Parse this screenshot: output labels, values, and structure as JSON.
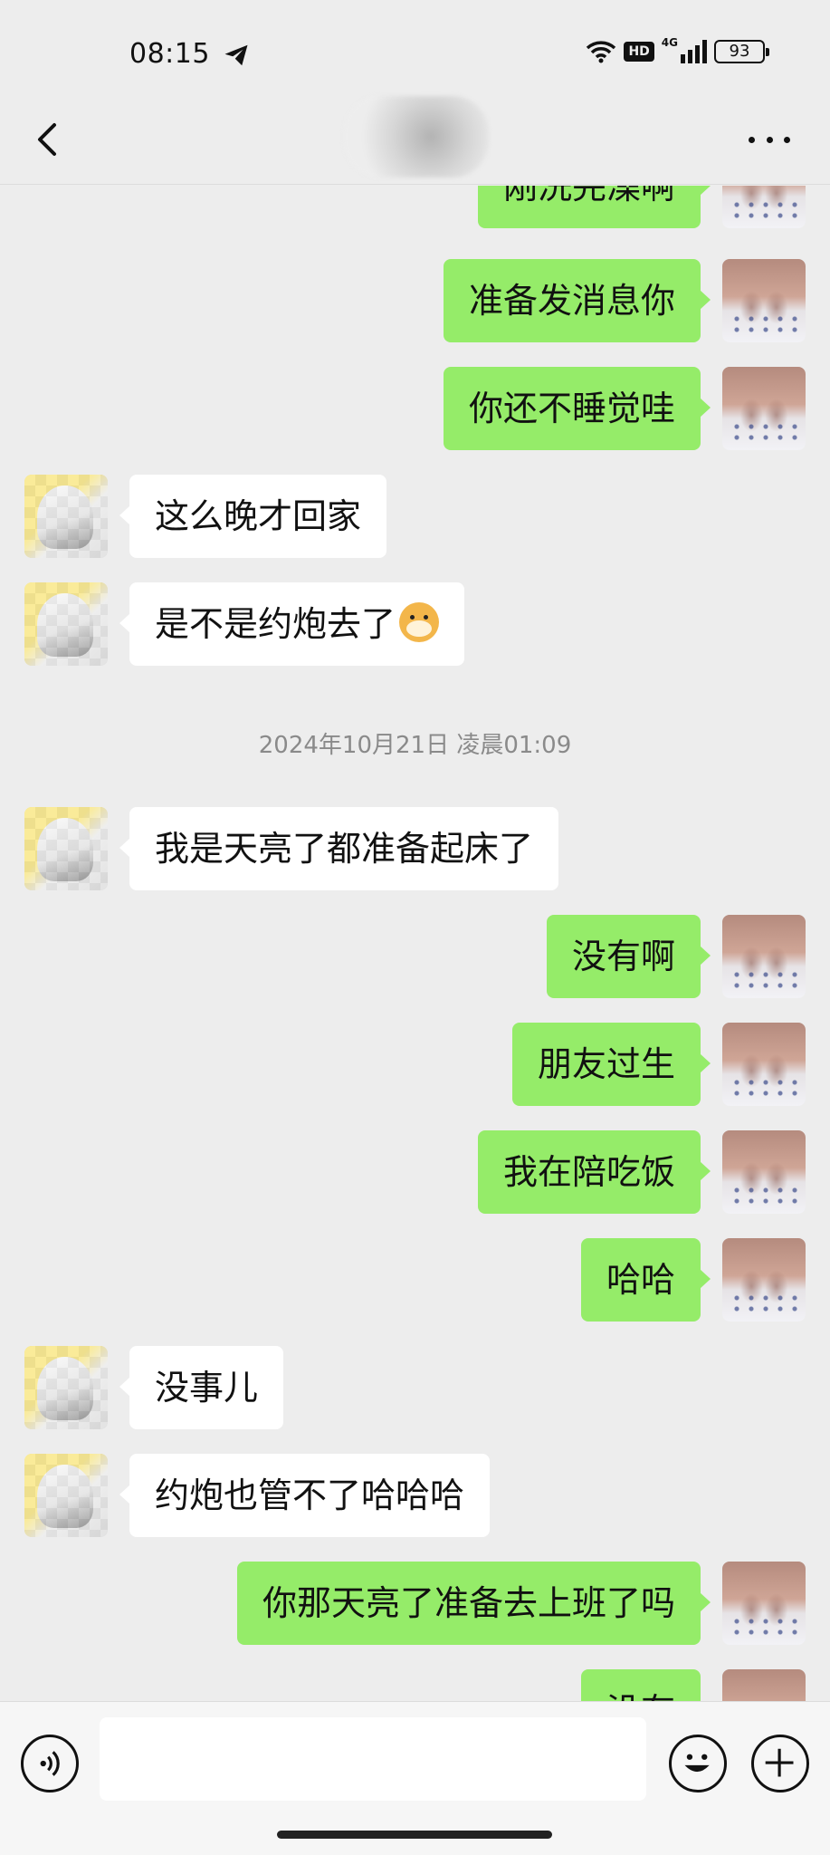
{
  "status_bar": {
    "time": "08:15",
    "hd": "HD",
    "network": "4G",
    "battery": "93"
  },
  "nav": {
    "back_icon": "chevron-left-icon",
    "more_icon": "more-dots-icon"
  },
  "messages": [
    {
      "side": "out",
      "text": "刚洗完澡啊"
    },
    {
      "side": "out",
      "text": "准备发消息你"
    },
    {
      "side": "out",
      "text": "你还不睡觉哇"
    },
    {
      "side": "in",
      "text": "这么晚才回家"
    },
    {
      "side": "in",
      "text": "是不是约炮去了",
      "emoji": "doge-emoji"
    },
    {
      "side": "in",
      "text": "我是天亮了都准备起床了"
    },
    {
      "side": "out",
      "text": "没有啊"
    },
    {
      "side": "out",
      "text": "朋友过生"
    },
    {
      "side": "out",
      "text": "我在陪吃饭"
    },
    {
      "side": "out",
      "text": "哈哈"
    },
    {
      "side": "in",
      "text": "没事儿"
    },
    {
      "side": "in",
      "text": "约炮也管不了哈哈哈"
    },
    {
      "side": "out",
      "text": "你那天亮了准备去上班了吗"
    },
    {
      "side": "out",
      "text": "没有"
    }
  ],
  "timestamp": "2024年10月21日 凌晨01:09",
  "input_bar": {
    "voice_icon": "voice-icon",
    "emoji_icon": "emoji-icon",
    "plus_icon": "plus-icon",
    "input_value": ""
  },
  "colors": {
    "background": "#ededed",
    "outgoing_bubble": "#95ec69",
    "incoming_bubble": "#ffffff",
    "timestamp_text": "#8a8a8a"
  }
}
